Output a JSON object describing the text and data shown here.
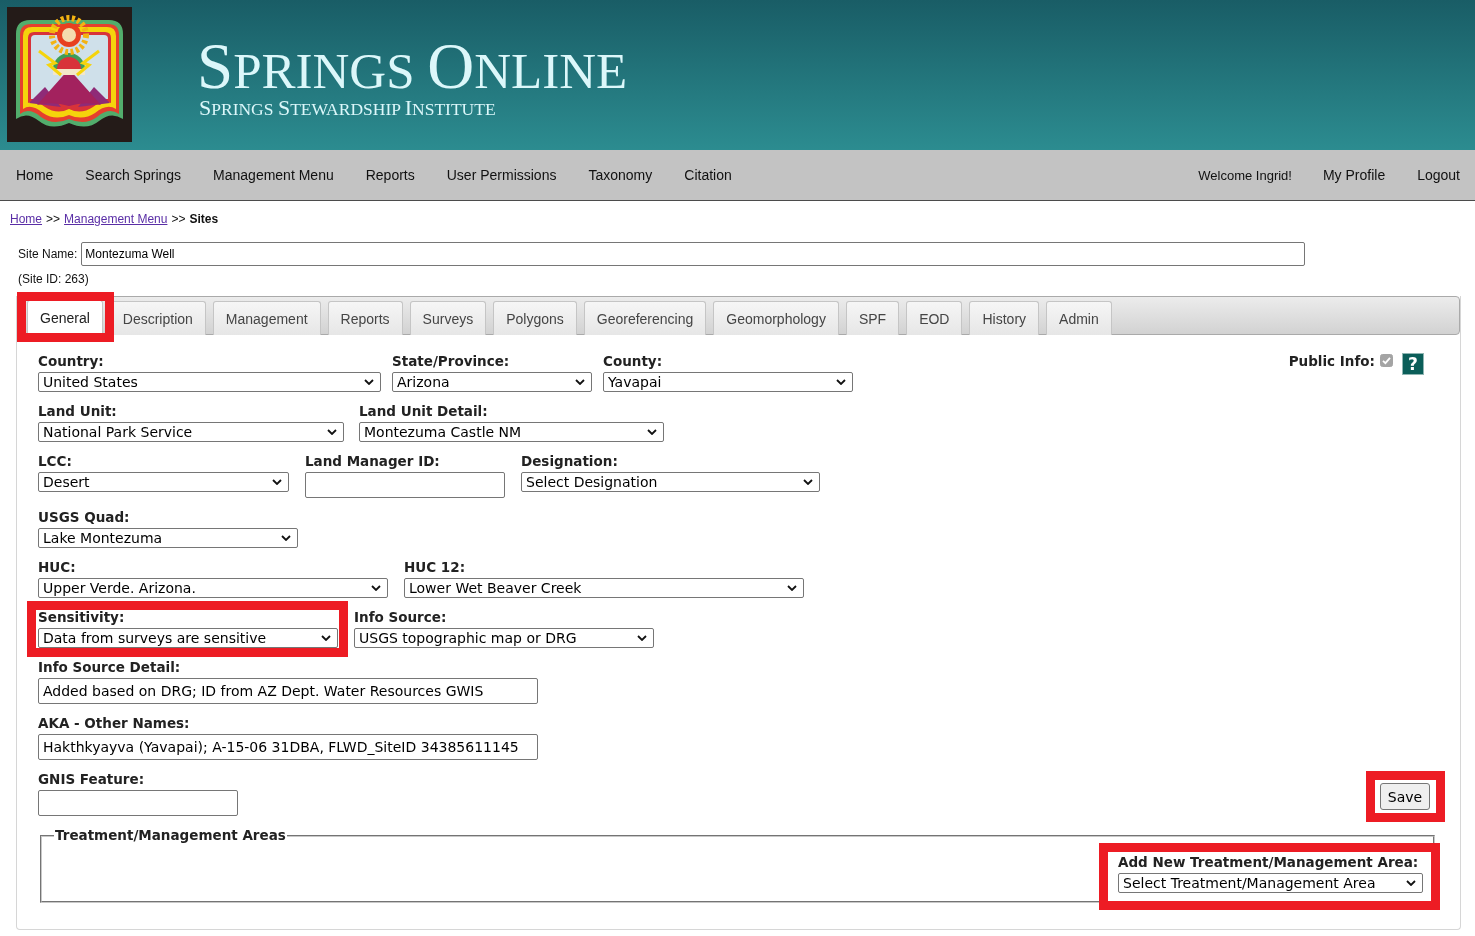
{
  "header": {
    "title": "SPRINGS ONLINE",
    "subtitle": "SPRINGS STEWARDSHIP INSTITUTE"
  },
  "nav": {
    "items": [
      "Home",
      "Search Springs",
      "Management Menu",
      "Reports",
      "User Permissions",
      "Taxonomy",
      "Citation"
    ],
    "welcome": "Welcome Ingrid!",
    "right_items": [
      "My Profile",
      "Logout"
    ]
  },
  "breadcrumb": [
    {
      "label": "Home",
      "kind": "link"
    },
    {
      "label": ">>",
      "kind": "separator"
    },
    {
      "label": "Management Menu",
      "kind": "link"
    },
    {
      "label": ">>",
      "kind": "separator"
    },
    {
      "label": "Sites",
      "kind": "current"
    }
  ],
  "site": {
    "name_label": "Site Name:",
    "name_value": "Montezuma Well",
    "id_text": "(Site ID: 263)"
  },
  "tabs": [
    {
      "label": "General",
      "selected": true,
      "highlighted": true
    },
    {
      "label": "Description",
      "selected": false,
      "highlighted": false
    },
    {
      "label": "Management",
      "selected": false,
      "highlighted": false
    },
    {
      "label": "Reports",
      "selected": false,
      "highlighted": false
    },
    {
      "label": "Surveys",
      "selected": false,
      "highlighted": false
    },
    {
      "label": "Polygons",
      "selected": false,
      "highlighted": false
    },
    {
      "label": "Georeferencing",
      "selected": false,
      "highlighted": false
    },
    {
      "label": "Geomorphology",
      "selected": false,
      "highlighted": false
    },
    {
      "label": "SPF",
      "selected": false,
      "highlighted": false
    },
    {
      "label": "EOD",
      "selected": false,
      "highlighted": false
    },
    {
      "label": "History",
      "selected": false,
      "highlighted": false
    },
    {
      "label": "Admin",
      "selected": false,
      "highlighted": false
    }
  ],
  "form": {
    "rows": [
      [
        {
          "label": "Country:",
          "kind": "select",
          "value": "United States",
          "highlighted": false
        },
        {
          "label": "State/Province:",
          "kind": "select",
          "value": "Arizona",
          "highlighted": false
        },
        {
          "label": "County:",
          "kind": "select",
          "value": "Yavapai",
          "highlighted": false
        }
      ],
      [
        {
          "label": "Land Unit:",
          "kind": "select",
          "value": "National Park Service",
          "highlighted": false
        },
        {
          "label": "Land Unit Detail:",
          "kind": "select",
          "value": "Montezuma Castle NM",
          "highlighted": false
        }
      ],
      [
        {
          "label": "LCC:",
          "kind": "select",
          "value": "Desert",
          "highlighted": false
        },
        {
          "label": "Land Manager ID:",
          "kind": "input",
          "highlighted": false
        },
        {
          "label": "Designation:",
          "kind": "select",
          "value": "Select Designation",
          "highlighted": false
        }
      ],
      [
        {
          "label": "USGS Quad:",
          "kind": "select",
          "value": "Lake Montezuma",
          "highlighted": false
        }
      ],
      [
        {
          "label": "HUC:",
          "kind": "select",
          "value": "Upper Verde. Arizona.",
          "highlighted": false
        },
        {
          "label": "HUC 12:",
          "kind": "select",
          "value": "Lower Wet Beaver Creek",
          "highlighted": false
        }
      ],
      [
        {
          "label": "Sensitivity:",
          "kind": "select",
          "value": "Data from surveys are sensitive",
          "highlighted": true
        },
        {
          "label": "Info Source:",
          "kind": "select",
          "value": "USGS topographic map or DRG",
          "highlighted": false
        }
      ],
      [
        {
          "label": "Info Source Detail:",
          "kind": "input",
          "value": "Added based on DRG; ID from AZ Dept. Water Resources GWIS",
          "highlighted": false
        }
      ],
      [
        {
          "label": "AKA - Other Names:",
          "kind": "input",
          "value": "Hakthkyayva (Yavapai); A-15-06 31DBA, FLWD_SiteID 34385611145",
          "highlighted": false
        }
      ],
      [
        {
          "label": "GNIS Feature:",
          "kind": "input",
          "highlighted": false
        }
      ]
    ],
    "public_info": {
      "label": "Public Info:",
      "checked": true,
      "disabled": true
    },
    "help": "?"
  },
  "save": {
    "label": "Save",
    "highlighted": true
  },
  "treatment": {
    "legend": "Treatment/Management Areas",
    "add_label": "Add New Treatment/Management Area:",
    "add_value": "Select Treatment/Management Area",
    "highlighted": true
  }
}
